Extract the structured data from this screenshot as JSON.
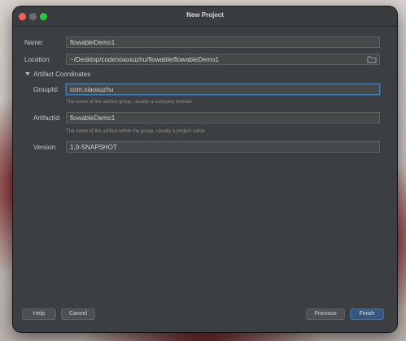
{
  "window": {
    "title": "New Project"
  },
  "form": {
    "name": {
      "label": "Name:",
      "value": "flowableDemo1"
    },
    "location": {
      "label": "Location:",
      "value": "~/Desktop/code/xiaoxuzhu/flowable/flowableDemo1"
    },
    "artifact_section": {
      "label": "Artifact Coordinates",
      "expanded": true
    },
    "group_id": {
      "label": "GroupId:",
      "value": "com.xiaoxuzhu",
      "hint": "The name of the artifact group, usually a company domain"
    },
    "artifact_id": {
      "label": "ArtifactId:",
      "value": "flowableDemo1",
      "hint": "The name of the artifact within the group, usually a project name"
    },
    "version": {
      "label": "Version:",
      "value": "1.0-SNAPSHOT"
    }
  },
  "buttons": {
    "help": "Help",
    "cancel": "Cancel",
    "previous": "Previous",
    "finish": "Finish"
  },
  "icons": {
    "browse": "folder-icon",
    "toggle": "triangle-down-icon"
  },
  "colors": {
    "dialog_bg": "#3c3f41",
    "field_bg": "#45494a",
    "focus_border": "#3d7fc4",
    "primary_button": "#365880",
    "close": "#ff5f57",
    "maximize": "#28c840"
  }
}
